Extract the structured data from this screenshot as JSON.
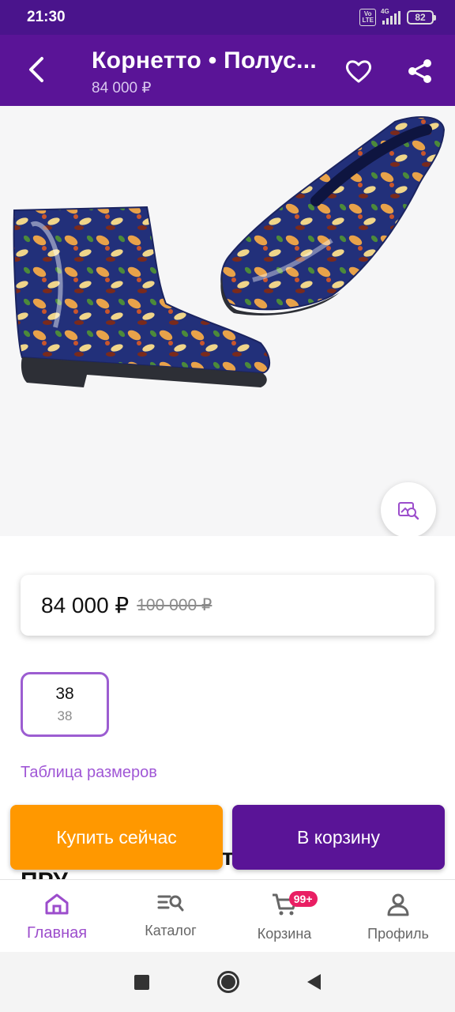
{
  "status_bar": {
    "time": "21:30",
    "volte_label": "Vo LTE",
    "network_label": "4G",
    "battery_level": "82"
  },
  "app_bar": {
    "title": "Корнетто • Полус...",
    "subtitle": "84 000 ₽",
    "back_icon": "chevron-left-icon",
    "favorite_icon": "heart-outline-icon",
    "share_icon": "share-icon"
  },
  "product": {
    "image_alt_icon": "rubber-boots-floral",
    "zoom_icon": "image-search-icon",
    "price": "84 000 ₽",
    "old_price": "100 000 ₽",
    "sizes": [
      {
        "label": "38",
        "sublabel": "38",
        "selected": true
      }
    ],
    "size_table_link": "Таблица размеров",
    "peek_text_1": "т",
    "peek_text_2": "ПРУ"
  },
  "actions": {
    "buy_now": "Купить сейчас",
    "add_to_cart": "В корзину"
  },
  "bottom_nav": {
    "items": [
      {
        "label": "Главная",
        "icon": "home-icon",
        "active": true
      },
      {
        "label": "Каталог",
        "icon": "catalog-search-icon",
        "active": false
      },
      {
        "label": "Корзина",
        "icon": "cart-icon",
        "active": false,
        "badge": "99+"
      },
      {
        "label": "Профиль",
        "icon": "profile-icon",
        "active": false
      }
    ]
  },
  "colors": {
    "primary": "#5a1497",
    "status_bar": "#4a148c",
    "accent_orange": "#ff9800",
    "accent_lilac": "#9c4dcc",
    "badge": "#e91e63"
  }
}
